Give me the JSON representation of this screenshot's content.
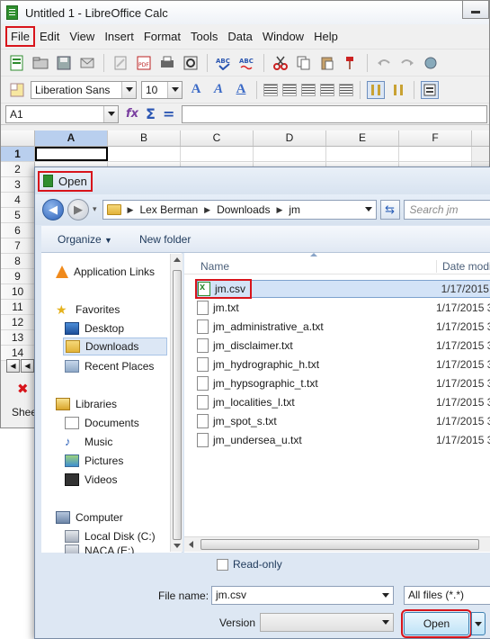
{
  "calc": {
    "title": "Untitled 1 - LibreOffice Calc",
    "menu": [
      "File",
      "Edit",
      "View",
      "Insert",
      "Format",
      "Tools",
      "Data",
      "Window",
      "Help"
    ],
    "font_name": "Liberation Sans",
    "font_size": "10",
    "cell_ref": "A1",
    "columns": [
      "A",
      "B",
      "C",
      "D",
      "E",
      "F"
    ],
    "rows": [
      "1",
      "2",
      "3",
      "4",
      "5",
      "6",
      "7",
      "8",
      "9",
      "10",
      "11",
      "12",
      "13",
      "14"
    ],
    "sheet_status": "Shee"
  },
  "dialog": {
    "title": "Open",
    "breadcrumb": [
      "Lex Berman",
      "Downloads",
      "jm"
    ],
    "search_placeholder": "Search jm",
    "organize": "Organize",
    "new_folder": "New folder",
    "nav": {
      "application_links": "Application Links",
      "favorites": "Favorites",
      "desktop": "Desktop",
      "downloads": "Downloads",
      "recent_places": "Recent Places",
      "libraries": "Libraries",
      "documents": "Documents",
      "music": "Music",
      "pictures": "Pictures",
      "videos": "Videos",
      "computer": "Computer",
      "local_disk": "Local Disk (C:)",
      "next_drive_partial": "NACA (E:)"
    },
    "columns": {
      "name": "Name",
      "date": "Date modifi"
    },
    "files": [
      {
        "name": "jm.csv",
        "date": "1/17/2015 3"
      },
      {
        "name": "jm.txt",
        "date": "1/17/2015 3"
      },
      {
        "name": "jm_administrative_a.txt",
        "date": "1/17/2015 3"
      },
      {
        "name": "jm_disclaimer.txt",
        "date": "1/17/2015 3"
      },
      {
        "name": "jm_hydrographic_h.txt",
        "date": "1/17/2015 3"
      },
      {
        "name": "jm_hypsographic_t.txt",
        "date": "1/17/2015 3"
      },
      {
        "name": "jm_localities_l.txt",
        "date": "1/17/2015 3"
      },
      {
        "name": "jm_spot_s.txt",
        "date": "1/17/2015 3"
      },
      {
        "name": "jm_undersea_u.txt",
        "date": "1/17/2015 3"
      }
    ],
    "read_only": "Read-only",
    "file_name_label": "File name:",
    "file_name_value": "jm.csv",
    "file_type": "All files (*.*)",
    "version_label": "Version",
    "open_button": "Open"
  }
}
